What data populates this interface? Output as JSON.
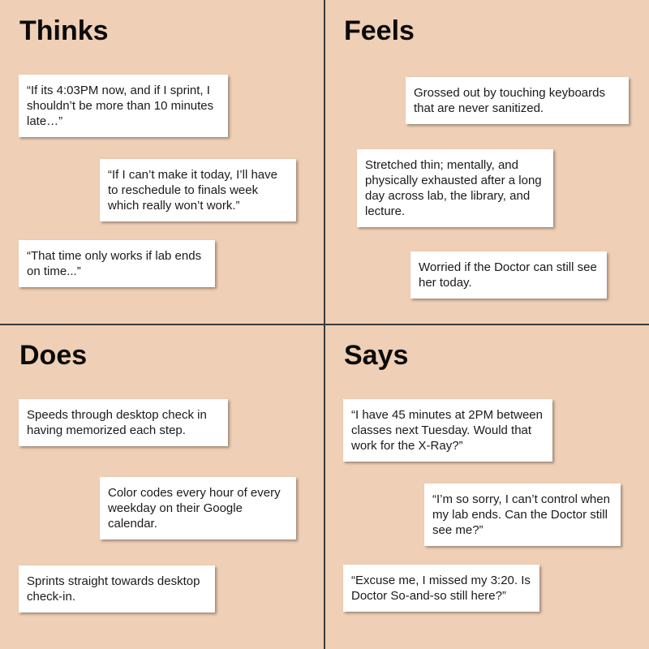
{
  "quadrants": {
    "thinks": {
      "title": "Thinks",
      "notes": [
        "“If its 4:03PM now, and if I sprint, I shouldn’t be more than 10 minutes late…”",
        "“If I can’t make it today, I’ll have to reschedule to finals week which really won’t work.”",
        "“That time only works if lab ends on time...”"
      ]
    },
    "feels": {
      "title": "Feels",
      "notes": [
        "Grossed out by touching keyboards that are never sanitized.",
        "Stretched thin; mentally, and physically exhausted after a long day across lab, the library, and lecture.",
        "Worried if the Doctor can still see her today."
      ]
    },
    "does": {
      "title": "Does",
      "notes": [
        "Speeds through desktop check in having memorized each step.",
        "Color codes every hour of every weekday on their Google calendar.",
        "Sprints straight towards desktop check-in."
      ]
    },
    "says": {
      "title": "Says",
      "notes": [
        "“I have 45 minutes at 2PM between classes next Tuesday. Would that work for the X-Ray?”",
        "“I’m so sorry, I can’t control when my lab ends. Can the Doctor still see me?”",
        "“Excuse me, I missed my 3:20. Is Doctor So-and-so still here?”"
      ]
    }
  },
  "colors": {
    "background": "#efcfb5",
    "note": "#ffffff",
    "divider": "#3a3a3a"
  }
}
